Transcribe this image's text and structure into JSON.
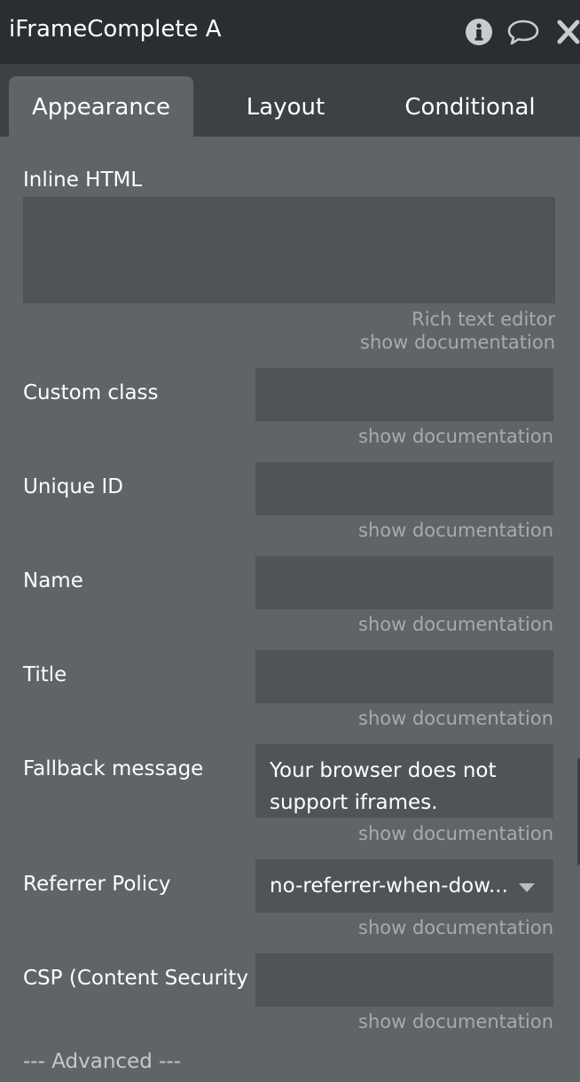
{
  "header": {
    "title": "iFrameComplete A",
    "icons": [
      "info-icon",
      "comment-icon",
      "close-icon"
    ]
  },
  "tabs": [
    {
      "label": "Appearance",
      "active": true
    },
    {
      "label": "Layout",
      "active": false
    },
    {
      "label": "Conditional",
      "active": false
    }
  ],
  "cutoff_doc": "show documentation",
  "inline_html": {
    "label": "Inline HTML",
    "value": "",
    "rich_text_editor": "Rich text editor",
    "doc": "show documentation"
  },
  "fields": {
    "custom_class": {
      "label": "Custom class",
      "value": "",
      "doc": "show documentation"
    },
    "unique_id": {
      "label": "Unique ID",
      "value": "",
      "doc": "show documentation"
    },
    "name": {
      "label": "Name",
      "value": "",
      "doc": "show documentation"
    },
    "title": {
      "label": "Title",
      "value": "",
      "doc": "show documentation"
    },
    "fallback": {
      "label": "Fallback message",
      "value": "Your browser does not support iframes.",
      "doc": "show documentation"
    },
    "referrer": {
      "label": "Referrer Policy",
      "value": "no-referrer-when-dow...",
      "doc": "show documentation"
    },
    "csp": {
      "label": "CSP (Content Security",
      "value": "",
      "doc": "show documentation"
    }
  },
  "advanced_label": "--- Advanced ---",
  "colors": {
    "header_bg": "#2a2e31",
    "tabbar_bg": "#3c4144",
    "panel_bg": "#5f6468",
    "field_bg": "#4f5457",
    "muted_text": "#a7abae"
  }
}
